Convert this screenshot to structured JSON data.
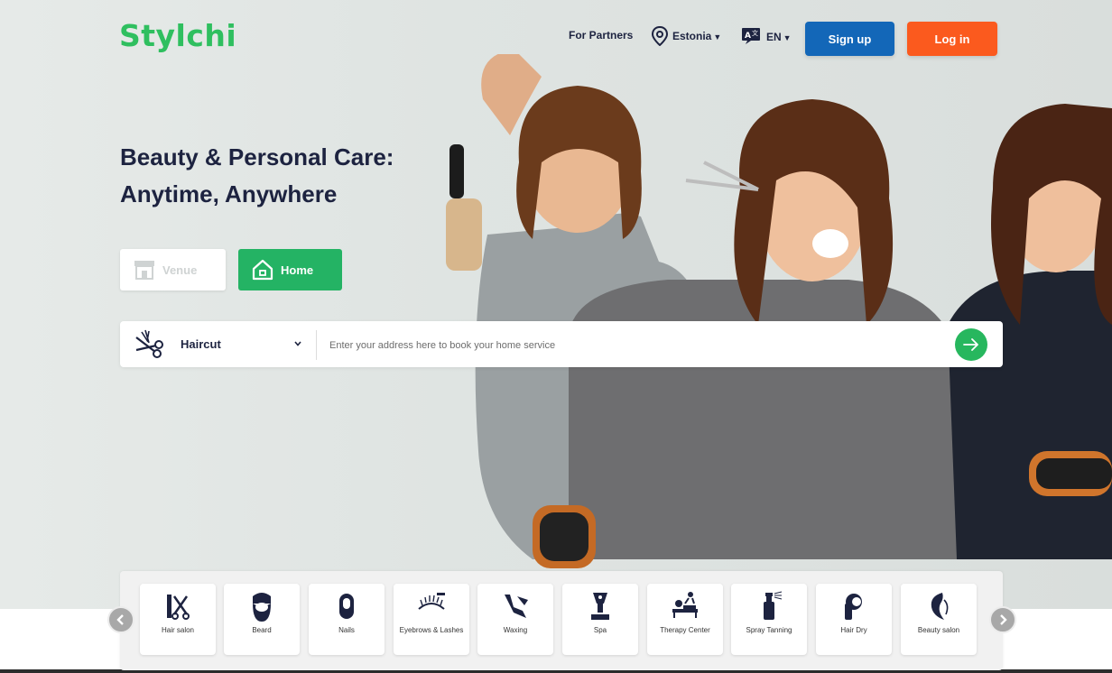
{
  "brand": {
    "logo": "Stylchi",
    "accent": "#2fbf5f"
  },
  "header": {
    "partners_link": "For Partners",
    "location": "Estonia",
    "language": "EN",
    "signup_label": "Sign up",
    "login_label": "Log in",
    "signup_color": "#1367b8",
    "login_color": "#fb5a1e"
  },
  "hero": {
    "headline_line1": "Beauty & Personal Care:",
    "headline_line2": "Anytime, Anywhere"
  },
  "modes": {
    "venue": "Venue",
    "home": "Home",
    "selected": "Home"
  },
  "search": {
    "service": "Haircut",
    "address_placeholder": "Enter your address here to book your home service",
    "address_value": ""
  },
  "categories": [
    {
      "label": "Hair salon",
      "icon": "hair-salon-icon"
    },
    {
      "label": "Beard",
      "icon": "beard-icon"
    },
    {
      "label": "Nails",
      "icon": "nails-icon"
    },
    {
      "label": "Eyebrows & Lashes",
      "icon": "eyebrows-lashes-icon"
    },
    {
      "label": "Waxing",
      "icon": "waxing-icon"
    },
    {
      "label": "Spa",
      "icon": "spa-icon"
    },
    {
      "label": "Therapy Center",
      "icon": "therapy-center-icon"
    },
    {
      "label": "Spray Tanning",
      "icon": "spray-tanning-icon"
    },
    {
      "label": "Hair Dry",
      "icon": "hair-dry-icon"
    },
    {
      "label": "Beauty salon",
      "icon": "beauty-salon-icon"
    }
  ]
}
